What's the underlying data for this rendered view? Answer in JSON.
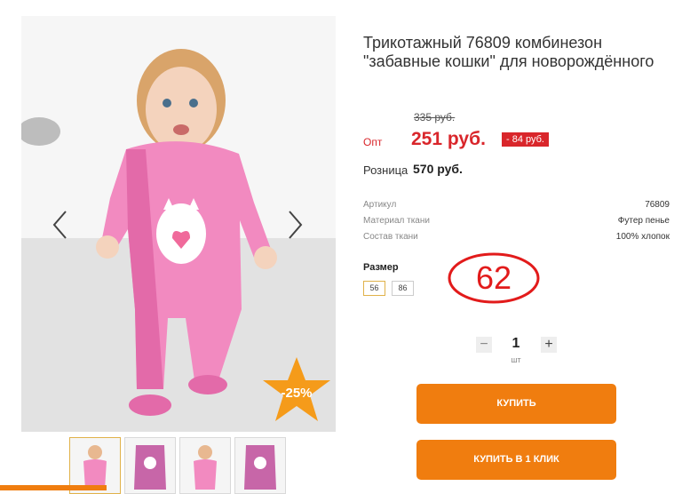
{
  "product": {
    "title": "Трикотажный 76809 комбинезон \"забавные кошки\" для новорождённого"
  },
  "pricing": {
    "old_price": "335 руб.",
    "opt_label": "Опт",
    "opt_price": "251 руб.",
    "discount_badge": "- 84 руб.",
    "retail_label": "Розница",
    "retail_price": "570 руб."
  },
  "gallery": {
    "discount_label": "-25%",
    "thumbnail_count": 4
  },
  "specs": [
    {
      "key": "Артикул",
      "value": "76809"
    },
    {
      "key": "Материал ткани",
      "value": "Футер пенье"
    },
    {
      "key": "Состав ткани",
      "value": "100% хлопок"
    }
  ],
  "size": {
    "label": "Размер",
    "options": [
      "56",
      "86"
    ],
    "selected": "56",
    "handwritten_note": "62"
  },
  "quantity": {
    "minus": "−",
    "value": "1",
    "plus": "+",
    "unit": "шт"
  },
  "actions": {
    "buy": "КУПИТЬ",
    "buy_one_click": "КУПИТЬ В 1 КЛИК"
  },
  "colors": {
    "accent_orange": "#f07d0f",
    "price_red": "#d9262b",
    "suit_pink": "#f28ac0"
  }
}
